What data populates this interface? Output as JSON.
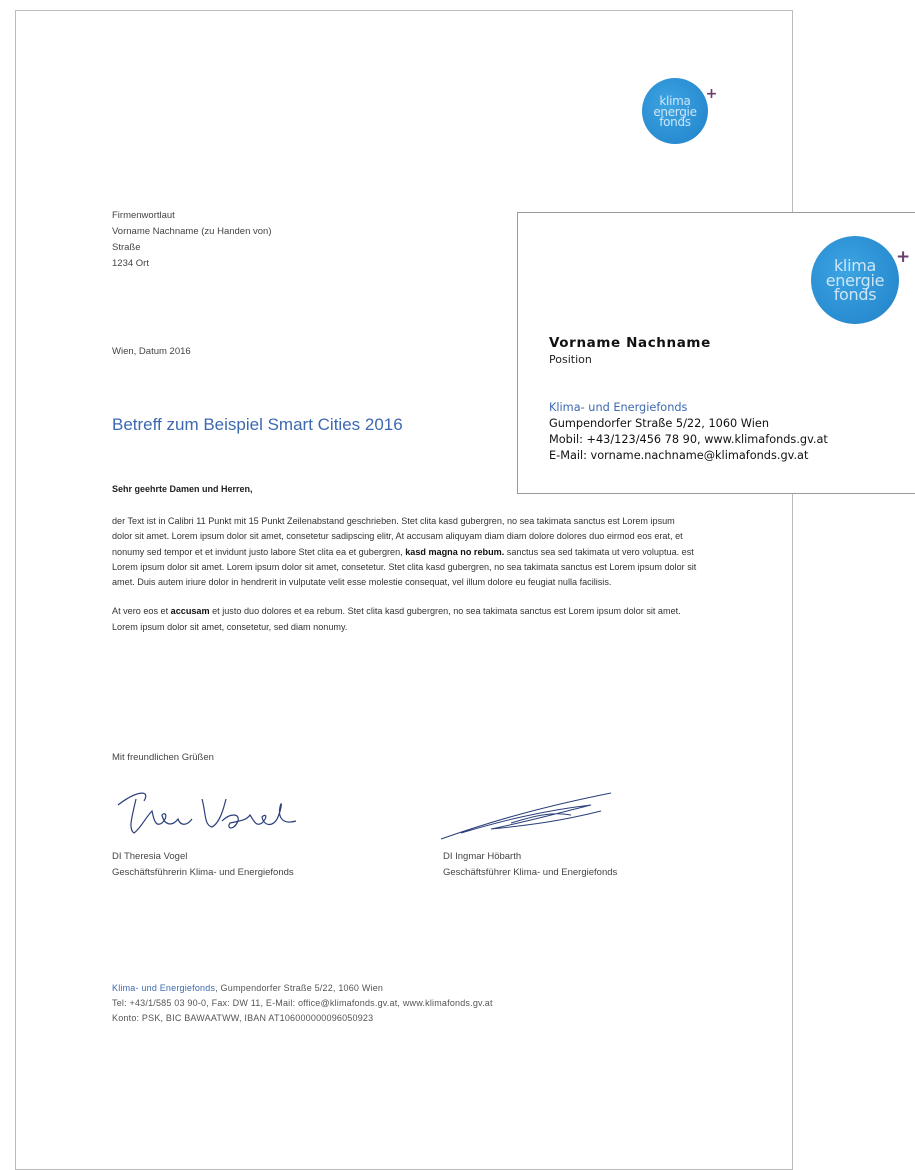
{
  "letter": {
    "logo": {
      "line1": "klima",
      "line2": "energie",
      "line3": "fonds",
      "plus": "+"
    },
    "recipient": {
      "company": "Firmenwortlaut",
      "name": "Vorname Nachname (zu Handen von)",
      "street": "Straße",
      "city": "1234  Ort"
    },
    "date": "Wien, Datum 2016",
    "subject": "Betreff zum Beispiel Smart Cities 2016",
    "salutation": "Sehr geehrte Damen und Herren,",
    "paragraph1": {
      "part1": "der Text ist in Calibri 11 Punkt mit 15 Punkt Zeilenabstand geschrieben. Stet clita kasd gubergren, no sea takimata sanctus est Lorem ipsum dolor sit amet. Lorem ipsum dolor sit amet, consetetur sadipscing elitr, At accusam aliquyam diam diam dolore dolores duo eirmod eos erat, et nonumy sed tempor et et invidunt justo labore Stet clita ea et gubergren, ",
      "bold": "kasd magna no rebum.",
      "part2": " sanctus sea sed takimata ut vero voluptua. est Lorem ipsum dolor sit amet. Lorem ipsum dolor sit amet, consetetur. Stet clita kasd gubergren, no sea takimata sanctus est Lorem ipsum dolor sit amet. Duis autem iriure dolor in hendrerit in vulputate velit esse molestie consequat, vel illum dolore eu feugiat nulla facilisis."
    },
    "paragraph2": {
      "part1": "At vero eos et ",
      "bold": "accusam",
      "part2": " et justo duo dolores et ea rebum. Stet clita kasd gubergren, no sea takimata sanctus est Lorem ipsum dolor sit amet. Lorem ipsum dolor sit amet, consetetur, sed diam nonumy."
    },
    "closing": "Mit freundlichen Grüßen",
    "signer1": {
      "name": "DI Theresia Vogel",
      "title": "Geschäftsführerin Klima- und Energiefonds"
    },
    "signer2": {
      "name": "DI Ingmar Höbarth",
      "title": "Geschäftsführer Klima- und Energiefonds"
    },
    "footer": {
      "org": "Klima- und Energiefonds",
      "address": ", Gumpendorfer Straße 5/22, 1060 Wien",
      "contact": "Tel: +43/1/585 03 90-0, Fax: DW 11, E-Mail: office@klimafonds.gv.at, www.klimafonds.gv.at",
      "bank": "Konto: PSK, BIC BAWAATWW, IBAN AT106000000096050923"
    }
  },
  "card": {
    "logo": {
      "line1": "klima",
      "line2": "energie",
      "line3": "fonds",
      "plus": "+"
    },
    "name": "Vorname Nachname",
    "position": "Position",
    "org": "Klima- und Energiefonds",
    "address": "Gumpendorfer Straße 5/22, 1060 Wien",
    "mobile": "Mobil: +43/123/456 78 90, www.klimafonds.gv.at",
    "email": "E-Mail: vorname.nachname@klimafonds.gv.at"
  },
  "colors": {
    "accent_blue": "#3d69b0",
    "logo_blue": "#2b8fd3",
    "logo_plus": "#6b3d6e"
  }
}
